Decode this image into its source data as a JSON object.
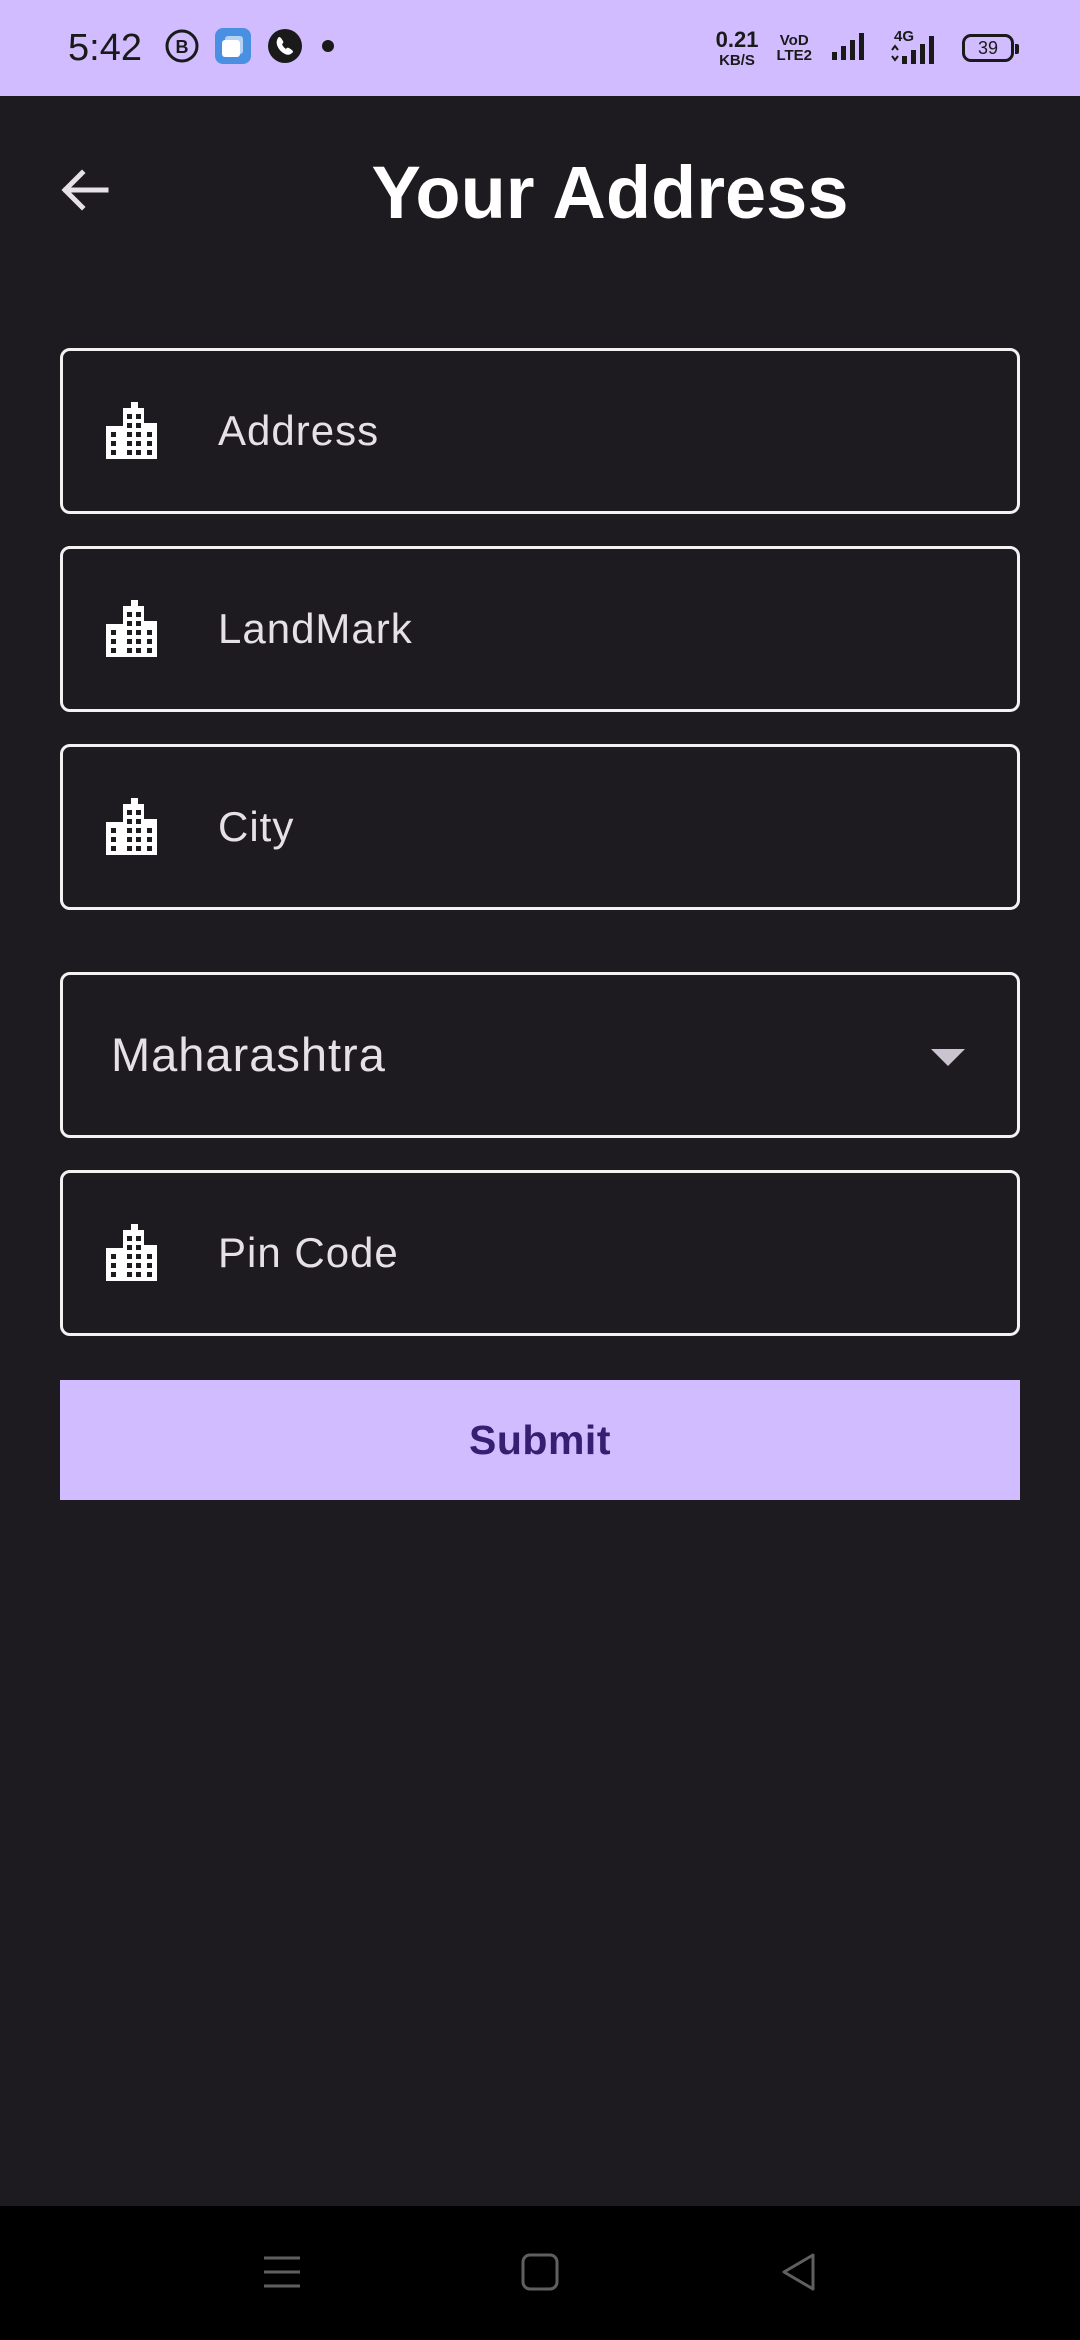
{
  "status_bar": {
    "time": "5:42",
    "net_speed_value": "0.21",
    "net_speed_unit": "KB/S",
    "volte_top": "VoD",
    "volte_bottom": "LTE2",
    "network_type": "4G",
    "battery_level": "39",
    "background_color": "#d0bcff",
    "left_icons": [
      "b-circle-icon",
      "app-notification-icon",
      "phone-call-icon",
      "dot-icon"
    ],
    "right_icons": [
      "signal-icon",
      "signal-4g-icon",
      "battery-icon"
    ]
  },
  "header": {
    "title": "Your Address",
    "back_icon": "arrow-left-icon"
  },
  "form": {
    "address": {
      "placeholder": "Address",
      "icon": "building-icon"
    },
    "landmark": {
      "placeholder": "LandMark",
      "icon": "building-icon"
    },
    "city": {
      "placeholder": "City",
      "icon": "building-icon"
    },
    "state": {
      "selected": "Maharashtra",
      "icon": "dropdown-arrow-icon"
    },
    "pincode": {
      "placeholder": "Pin Code",
      "icon": "building-icon"
    },
    "submit_label": "Submit"
  },
  "nav_bar": {
    "icons": [
      "menu-icon",
      "home-square-icon",
      "back-triangle-icon"
    ]
  },
  "colors": {
    "background": "#1d1b20",
    "accent": "#d0bcff",
    "on_accent": "#381e72",
    "text": "#e6e1e5",
    "border": "#f2f2f2"
  }
}
